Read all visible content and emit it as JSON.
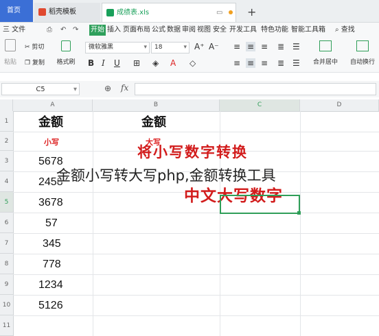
{
  "tabs": {
    "home": "首页",
    "template": "稻壳模板",
    "file": "成绩表.xls",
    "new_tab": "+"
  },
  "menu": {
    "file": "三 文件",
    "items": [
      "开始",
      "插入",
      "页面布局",
      "公式",
      "数据",
      "审阅",
      "视图",
      "安全",
      "开发工具",
      "特色功能",
      "智能工具箱"
    ],
    "search": "查找"
  },
  "ribbon": {
    "paste": "粘贴",
    "cut": "剪切",
    "copy": "复制",
    "format_painter": "格式刷",
    "font": "微软雅黑",
    "font_size": "18",
    "merge_center": "合并居中",
    "wrap_text": "自动换行"
  },
  "formula_bar": {
    "cell_ref": "C5",
    "fx": "fx"
  },
  "columns": [
    "A",
    "B",
    "C",
    "D"
  ],
  "rows": [
    "1",
    "2",
    "3",
    "4",
    "5",
    "6",
    "7",
    "8",
    "9",
    "10",
    "11"
  ],
  "sheet": {
    "a1": "金额",
    "b1": "金额",
    "a2": "小写",
    "b2": "大写",
    "values": [
      "5678",
      "2458",
      "3678",
      "57",
      "345",
      "778",
      "1234",
      "5126"
    ]
  },
  "watermark": {
    "top": "将小写数字转换",
    "bottom": "中文大写数字"
  },
  "overlay_title": "金额小写转大写php,金额转换工具",
  "colors": {
    "accent": "#2fa05c",
    "home_tab": "#3b6fd6",
    "watermark": "#d21c1c"
  }
}
